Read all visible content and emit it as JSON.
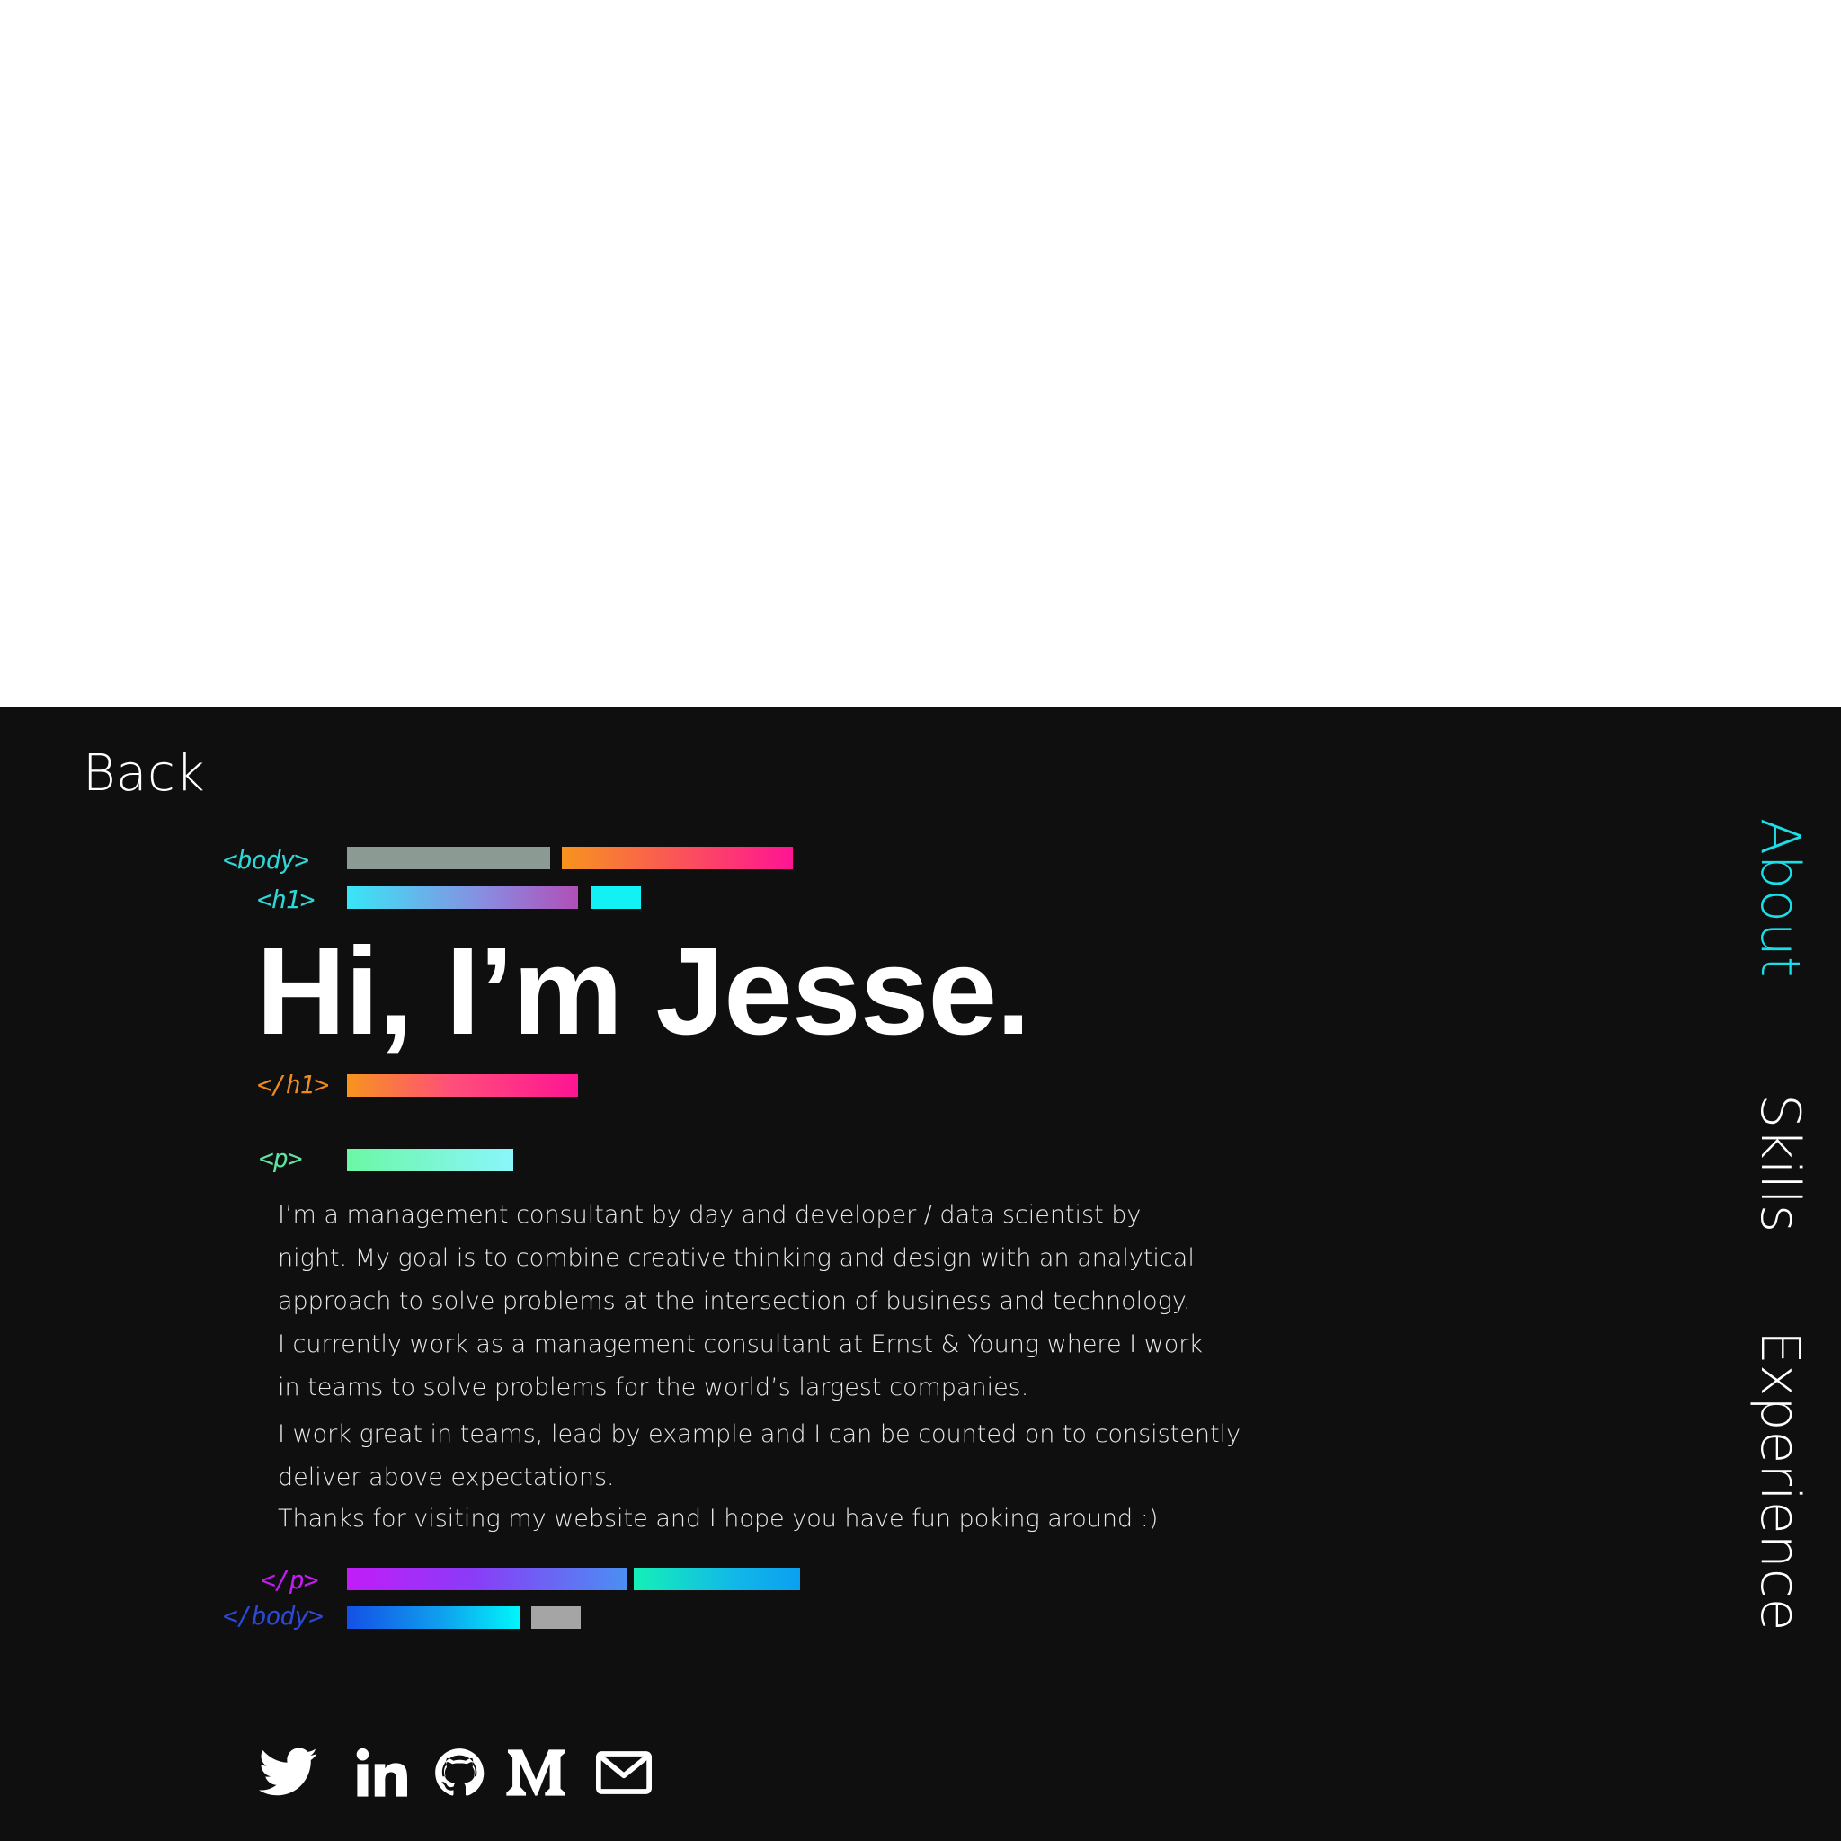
{
  "nav": {
    "back_label": "Back",
    "items": [
      {
        "label": "About",
        "color": "#19e0e8",
        "active": true
      },
      {
        "label": "Skills",
        "color": "#ffffff",
        "active": false
      },
      {
        "label": "Experience",
        "color": "#ffffff",
        "active": false
      }
    ]
  },
  "tags": {
    "body_open": "<body>",
    "h1_open": "<h1>",
    "h1_close": "</h1>",
    "p_open": "<p>",
    "p_close": "</p>",
    "body_close": "</body>"
  },
  "tag_colors": {
    "body_open": "#2fd6d6",
    "h1_open": "#2fd6d6",
    "h1_close": "#f08a1c",
    "p_open": "#5fe3a0",
    "p_close": "#c21cf0",
    "body_close": "#2b49d6"
  },
  "headline": "Hi, I’m Jesse.",
  "paragraph": [
    "I’m a  management consultant by day and developer / data scientist by",
    "night. My goal is to combine creative thinking and design with an analytical",
    "approach to solve problems at the intersection of business and technology.",
    "I currently work as a management consultant at Ernst & Young where I work",
    "in teams to solve problems for the world’s largest companies.",
    "I work great in teams, lead by example and I can be counted on to consistently",
    "deliver above expectations.",
    "Thanks for visiting my website and I hope you have fun poking around :)"
  ],
  "social": [
    {
      "name": "twitter-icon"
    },
    {
      "name": "linkedin-icon"
    },
    {
      "name": "github-icon"
    },
    {
      "name": "medium-icon"
    },
    {
      "name": "mail-icon"
    }
  ],
  "colors": {
    "background": "#0f0f10",
    "text": "#ffffff",
    "accent": "#19e0e8"
  }
}
